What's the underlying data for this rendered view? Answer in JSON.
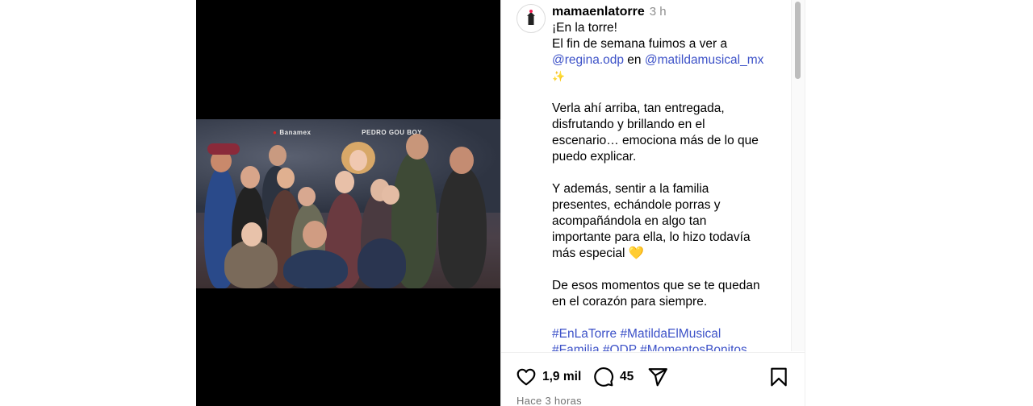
{
  "post": {
    "username": "mamaenlatorre",
    "time": "3 h",
    "caption_lines": [
      {
        "text": "¡En la torre!"
      },
      {
        "text": "El fin de semana fuimos a ver a"
      },
      {
        "mention1": "@regina.odp",
        "middle": " en ",
        "mention2": "@matildamusical_mx"
      },
      {
        "emoji": "✨"
      },
      {
        "text": ""
      },
      {
        "text": "Verla ahí arriba, tan entregada,"
      },
      {
        "text": "disfrutando y brillando en el"
      },
      {
        "text": "escenario… emociona más de lo que"
      },
      {
        "text": "puedo explicar."
      },
      {
        "text": ""
      },
      {
        "text": "Y además, sentir a la familia"
      },
      {
        "text": "presentes, echándole porras y"
      },
      {
        "text": "acompañándola en algo tan"
      },
      {
        "text": "importante para ella, lo hizo todavía"
      },
      {
        "text": "más especial",
        "emoji": "💛"
      },
      {
        "text": ""
      },
      {
        "text": "De esos momentos que se te quedan"
      },
      {
        "text": "en el corazón para siempre."
      },
      {
        "text": ""
      },
      {
        "hashtags": "#EnLaTorre #MatildaElMusical"
      },
      {
        "hashtags": "#Familia #ODP #MomentosBonitos"
      }
    ]
  },
  "photo": {
    "sponsor": "Banamex",
    "sponsor_extra": "PEDRO GOU BOY"
  },
  "actions": {
    "likes": "1,9 mil",
    "comments": "45",
    "posted_ago": "Hace 3 horas",
    "icons": [
      "heart-icon",
      "comment-icon",
      "share-icon",
      "bookmark-icon"
    ]
  }
}
